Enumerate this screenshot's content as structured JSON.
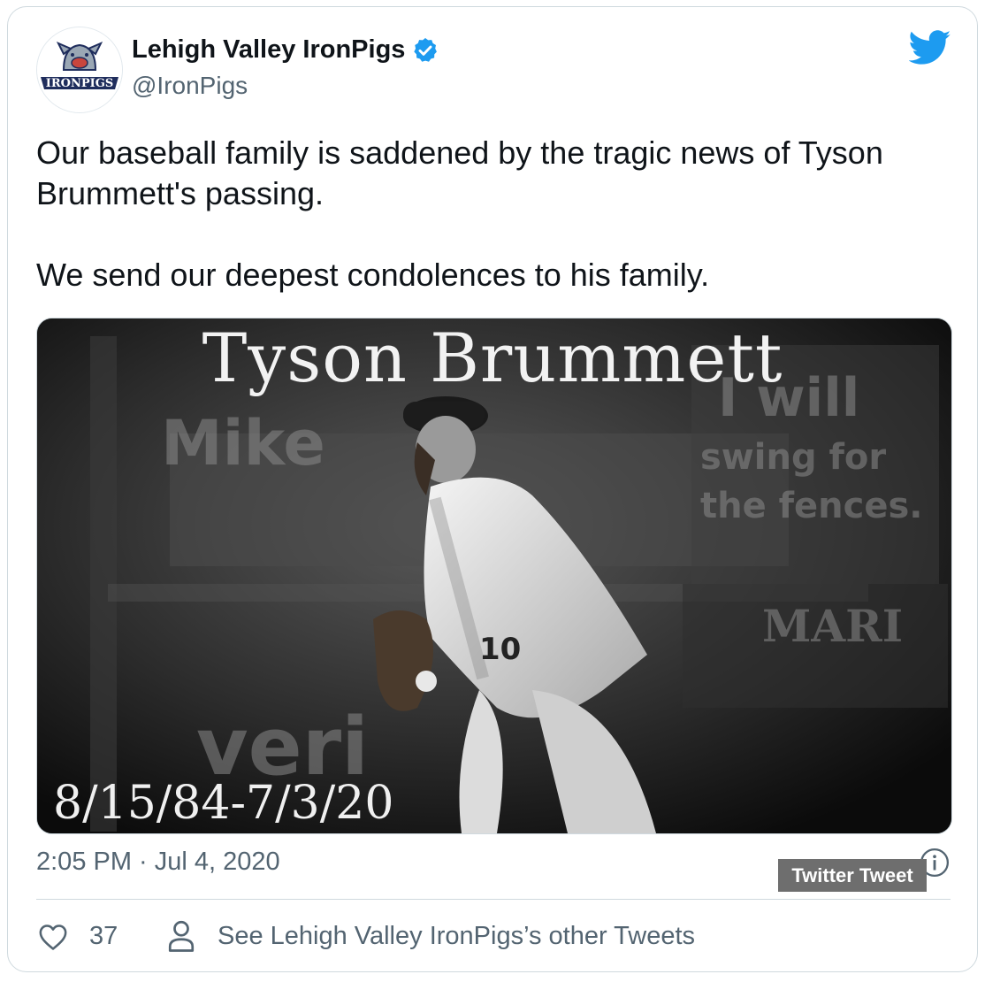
{
  "account": {
    "name": "Lehigh Valley IronPigs",
    "handle": "@IronPigs",
    "avatar_text": "IRONPIGS"
  },
  "tweet": {
    "paragraph1": "Our baseball family is saddened by the tragic news of Tyson Brummett's passing.",
    "paragraph2": "We send our deepest condolences to his family.",
    "timestamp": "2:05 PM · Jul 4, 2020"
  },
  "media": {
    "title": "Tyson Brummett",
    "dates": "8/15/84-7/3/20",
    "background_text": [
      "Mike",
      "I will",
      "swing for",
      "the fences.",
      "MARI",
      "veri"
    ]
  },
  "tooltip": {
    "label": "Twitter Tweet"
  },
  "actions": {
    "like_count": "37",
    "other_tweets_label": "See Lehigh Valley IronPigs’s other Tweets"
  },
  "icons": {
    "verified": "verified-badge-icon",
    "bird": "twitter-bird-icon",
    "info": "info-icon",
    "like": "heart-icon",
    "profile": "person-icon"
  },
  "colors": {
    "twitter_blue": "#1d9bf0",
    "text_primary": "#0f1419",
    "text_secondary": "#536471",
    "border": "#cfd9de"
  }
}
